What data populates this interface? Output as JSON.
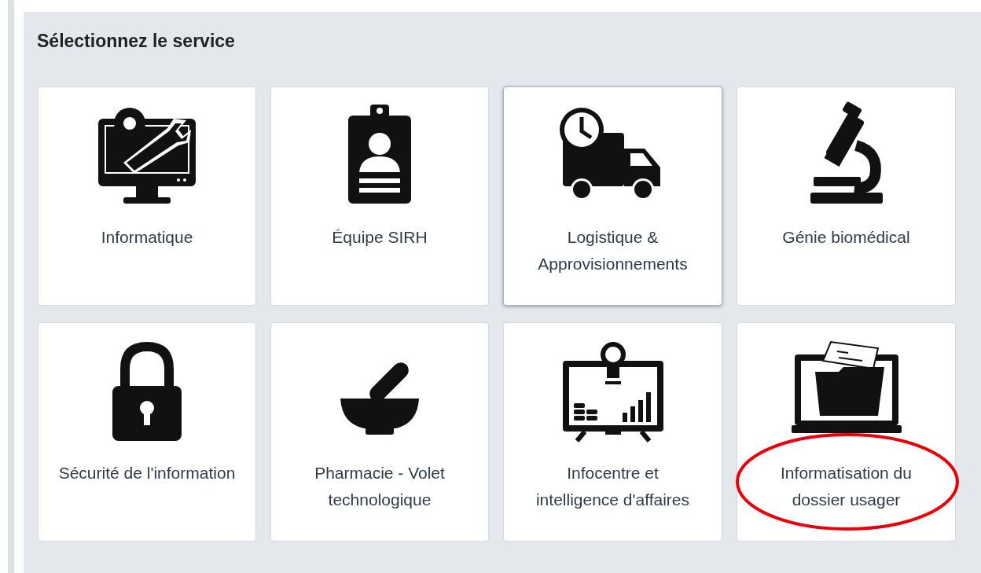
{
  "heading": "Sélectionnez le service",
  "services": [
    {
      "label": "Informatique",
      "selected": false,
      "circled": false
    },
    {
      "label": "Équipe SIRH",
      "selected": false,
      "circled": false
    },
    {
      "label": "Logistique & Approvisionnements",
      "selected": true,
      "circled": false
    },
    {
      "label": "Génie biomédical",
      "selected": false,
      "circled": false
    },
    {
      "label": "Sécurité de l'information",
      "selected": false,
      "circled": false
    },
    {
      "label": "Pharmacie - Volet technologique",
      "selected": false,
      "circled": false
    },
    {
      "label": "Infocentre et intelligence d'affaires",
      "selected": false,
      "circled": false
    },
    {
      "label": "Informatisation du dossier usager",
      "selected": false,
      "circled": true
    }
  ]
}
